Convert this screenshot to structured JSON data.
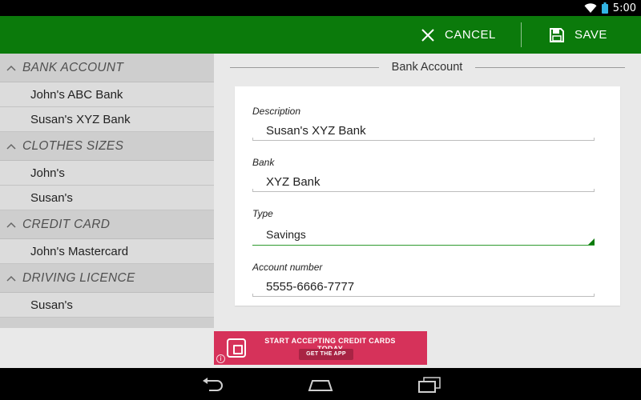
{
  "status_bar": {
    "time": "5:00"
  },
  "action_bar": {
    "cancel_label": "CANCEL",
    "save_label": "SAVE",
    "color": "#0b7a0b"
  },
  "sidebar": {
    "groups": [
      {
        "label": "BANK ACCOUNT",
        "items": [
          "John's ABC Bank",
          "Susan's XYZ Bank"
        ]
      },
      {
        "label": "CLOTHES SIZES",
        "items": [
          "John's",
          "Susan's"
        ]
      },
      {
        "label": "CREDIT CARD",
        "items": [
          "John's Mastercard"
        ]
      },
      {
        "label": "DRIVING LICENCE",
        "items": [
          "Susan's"
        ]
      }
    ]
  },
  "form": {
    "section_title": "Bank Account",
    "fields": {
      "description": {
        "label": "Description",
        "value": "Susan's XYZ Bank"
      },
      "bank": {
        "label": "Bank",
        "value": "XYZ Bank"
      },
      "type": {
        "label": "Type",
        "value": "Savings"
      },
      "account_number": {
        "label": "Account number",
        "value": "5555-6666-7777"
      }
    }
  },
  "ad": {
    "headline": "START ACCEPTING CREDIT CARDS TODAY",
    "cta": "GET THE APP",
    "info": "i",
    "color": "#d6325a"
  },
  "icons": {
    "cancel": "close-icon",
    "save": "floppy-disk-icon",
    "collapse": "chevron-up-icon",
    "wifi": "wifi-icon",
    "battery": "battery-icon",
    "back": "back-icon",
    "home": "home-icon",
    "recents": "recents-icon"
  }
}
